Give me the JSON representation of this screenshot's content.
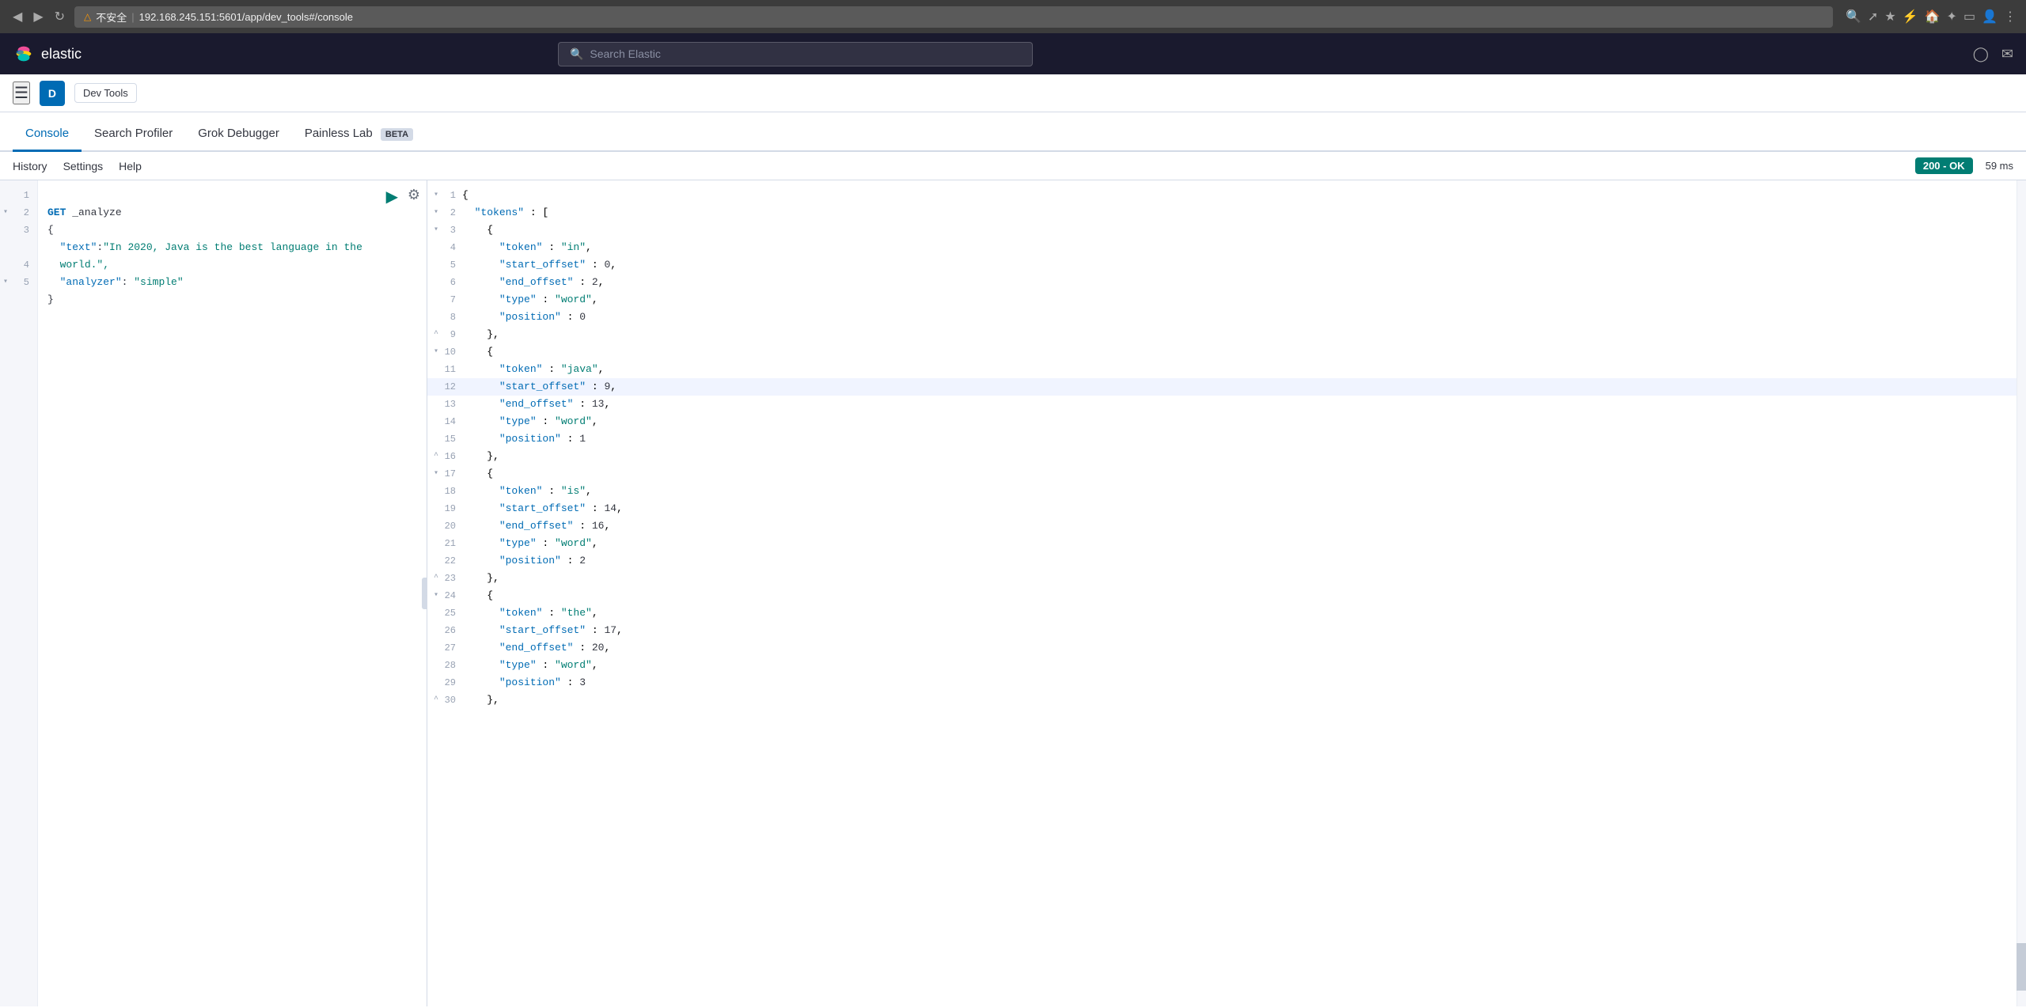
{
  "browser": {
    "url": "192.168.245.151:5601/app/dev_tools#/console",
    "warning": "不安全",
    "back_btn": "◀",
    "forward_btn": "▶",
    "reload_btn": "↻"
  },
  "header": {
    "logo_text": "elastic",
    "search_placeholder": "Search Elastic"
  },
  "app_nav": {
    "user_initial": "D",
    "app_label": "Dev Tools"
  },
  "tabs": [
    {
      "id": "console",
      "label": "Console",
      "active": true,
      "beta": false
    },
    {
      "id": "search-profiler",
      "label": "Search Profiler",
      "active": false,
      "beta": false
    },
    {
      "id": "grok-debugger",
      "label": "Grok Debugger",
      "active": false,
      "beta": false
    },
    {
      "id": "painless-lab",
      "label": "Painless Lab",
      "active": false,
      "beta": true
    }
  ],
  "beta_label": "BETA",
  "toolbar": {
    "history": "History",
    "settings": "Settings",
    "help": "Help",
    "status": "200 - OK",
    "time": "59 ms"
  },
  "input": {
    "lines": [
      {
        "num": "1",
        "content": "GET _analyze",
        "type": "command"
      },
      {
        "num": "2",
        "content": "{",
        "type": "brace",
        "collapse": "▾"
      },
      {
        "num": "3",
        "content": "    \"text\":\"In 2020, Java is the best language in the",
        "type": "string"
      },
      {
        "num": "  ",
        "content": "    world.\",",
        "type": "string"
      },
      {
        "num": "4",
        "content": "    \"analyzer\": \"simple\"",
        "type": "string"
      },
      {
        "num": "5",
        "content": "}",
        "type": "brace",
        "collapse": "▾"
      }
    ]
  },
  "output": {
    "lines": [
      {
        "num": "1",
        "caret": "▾",
        "text": "{",
        "highlighted": false
      },
      {
        "num": "2",
        "caret": "▾",
        "text": "  \"tokens\" : [",
        "highlighted": false
      },
      {
        "num": "3",
        "caret": "▾",
        "text": "    {",
        "highlighted": false
      },
      {
        "num": "4",
        "caret": "",
        "text": "      \"token\" : \"in\",",
        "highlighted": false
      },
      {
        "num": "5",
        "caret": "",
        "text": "      \"start_offset\" : 0,",
        "highlighted": false
      },
      {
        "num": "6",
        "caret": "",
        "text": "      \"end_offset\" : 2,",
        "highlighted": false
      },
      {
        "num": "7",
        "caret": "",
        "text": "      \"type\" : \"word\",",
        "highlighted": false
      },
      {
        "num": "8",
        "caret": "",
        "text": "      \"position\" : 0",
        "highlighted": false
      },
      {
        "num": "9",
        "caret": "^",
        "text": "    },",
        "highlighted": false
      },
      {
        "num": "10",
        "caret": "▾",
        "text": "    {",
        "highlighted": false
      },
      {
        "num": "11",
        "caret": "",
        "text": "      \"token\" : \"java\",",
        "highlighted": false
      },
      {
        "num": "12",
        "caret": "",
        "text": "      \"start_offset\" : 9,",
        "highlighted": true
      },
      {
        "num": "13",
        "caret": "",
        "text": "      \"end_offset\" : 13,",
        "highlighted": false
      },
      {
        "num": "14",
        "caret": "",
        "text": "      \"type\" : \"word\",",
        "highlighted": false
      },
      {
        "num": "15",
        "caret": "",
        "text": "      \"position\" : 1",
        "highlighted": false
      },
      {
        "num": "16",
        "caret": "^",
        "text": "    },",
        "highlighted": false
      },
      {
        "num": "17",
        "caret": "▾",
        "text": "    {",
        "highlighted": false
      },
      {
        "num": "18",
        "caret": "",
        "text": "      \"token\" : \"is\",",
        "highlighted": false
      },
      {
        "num": "19",
        "caret": "",
        "text": "      \"start_offset\" : 14,",
        "highlighted": false
      },
      {
        "num": "20",
        "caret": "",
        "text": "      \"end_offset\" : 16,",
        "highlighted": false
      },
      {
        "num": "21",
        "caret": "",
        "text": "      \"type\" : \"word\",",
        "highlighted": false
      },
      {
        "num": "22",
        "caret": "",
        "text": "      \"position\" : 2",
        "highlighted": false
      },
      {
        "num": "23",
        "caret": "^",
        "text": "    },",
        "highlighted": false
      },
      {
        "num": "24",
        "caret": "▾",
        "text": "    {",
        "highlighted": false
      },
      {
        "num": "25",
        "caret": "",
        "text": "      \"token\" : \"the\",",
        "highlighted": false
      },
      {
        "num": "26",
        "caret": "",
        "text": "      \"start_offset\" : 17,",
        "highlighted": false
      },
      {
        "num": "27",
        "caret": "",
        "text": "      \"end_offset\" : 20,",
        "highlighted": false
      },
      {
        "num": "28",
        "caret": "",
        "text": "      \"type\" : \"word\",",
        "highlighted": false
      },
      {
        "num": "29",
        "caret": "",
        "text": "      \"position\" : 3",
        "highlighted": false
      },
      {
        "num": "30",
        "caret": "^",
        "text": "    },",
        "highlighted": false
      }
    ]
  }
}
